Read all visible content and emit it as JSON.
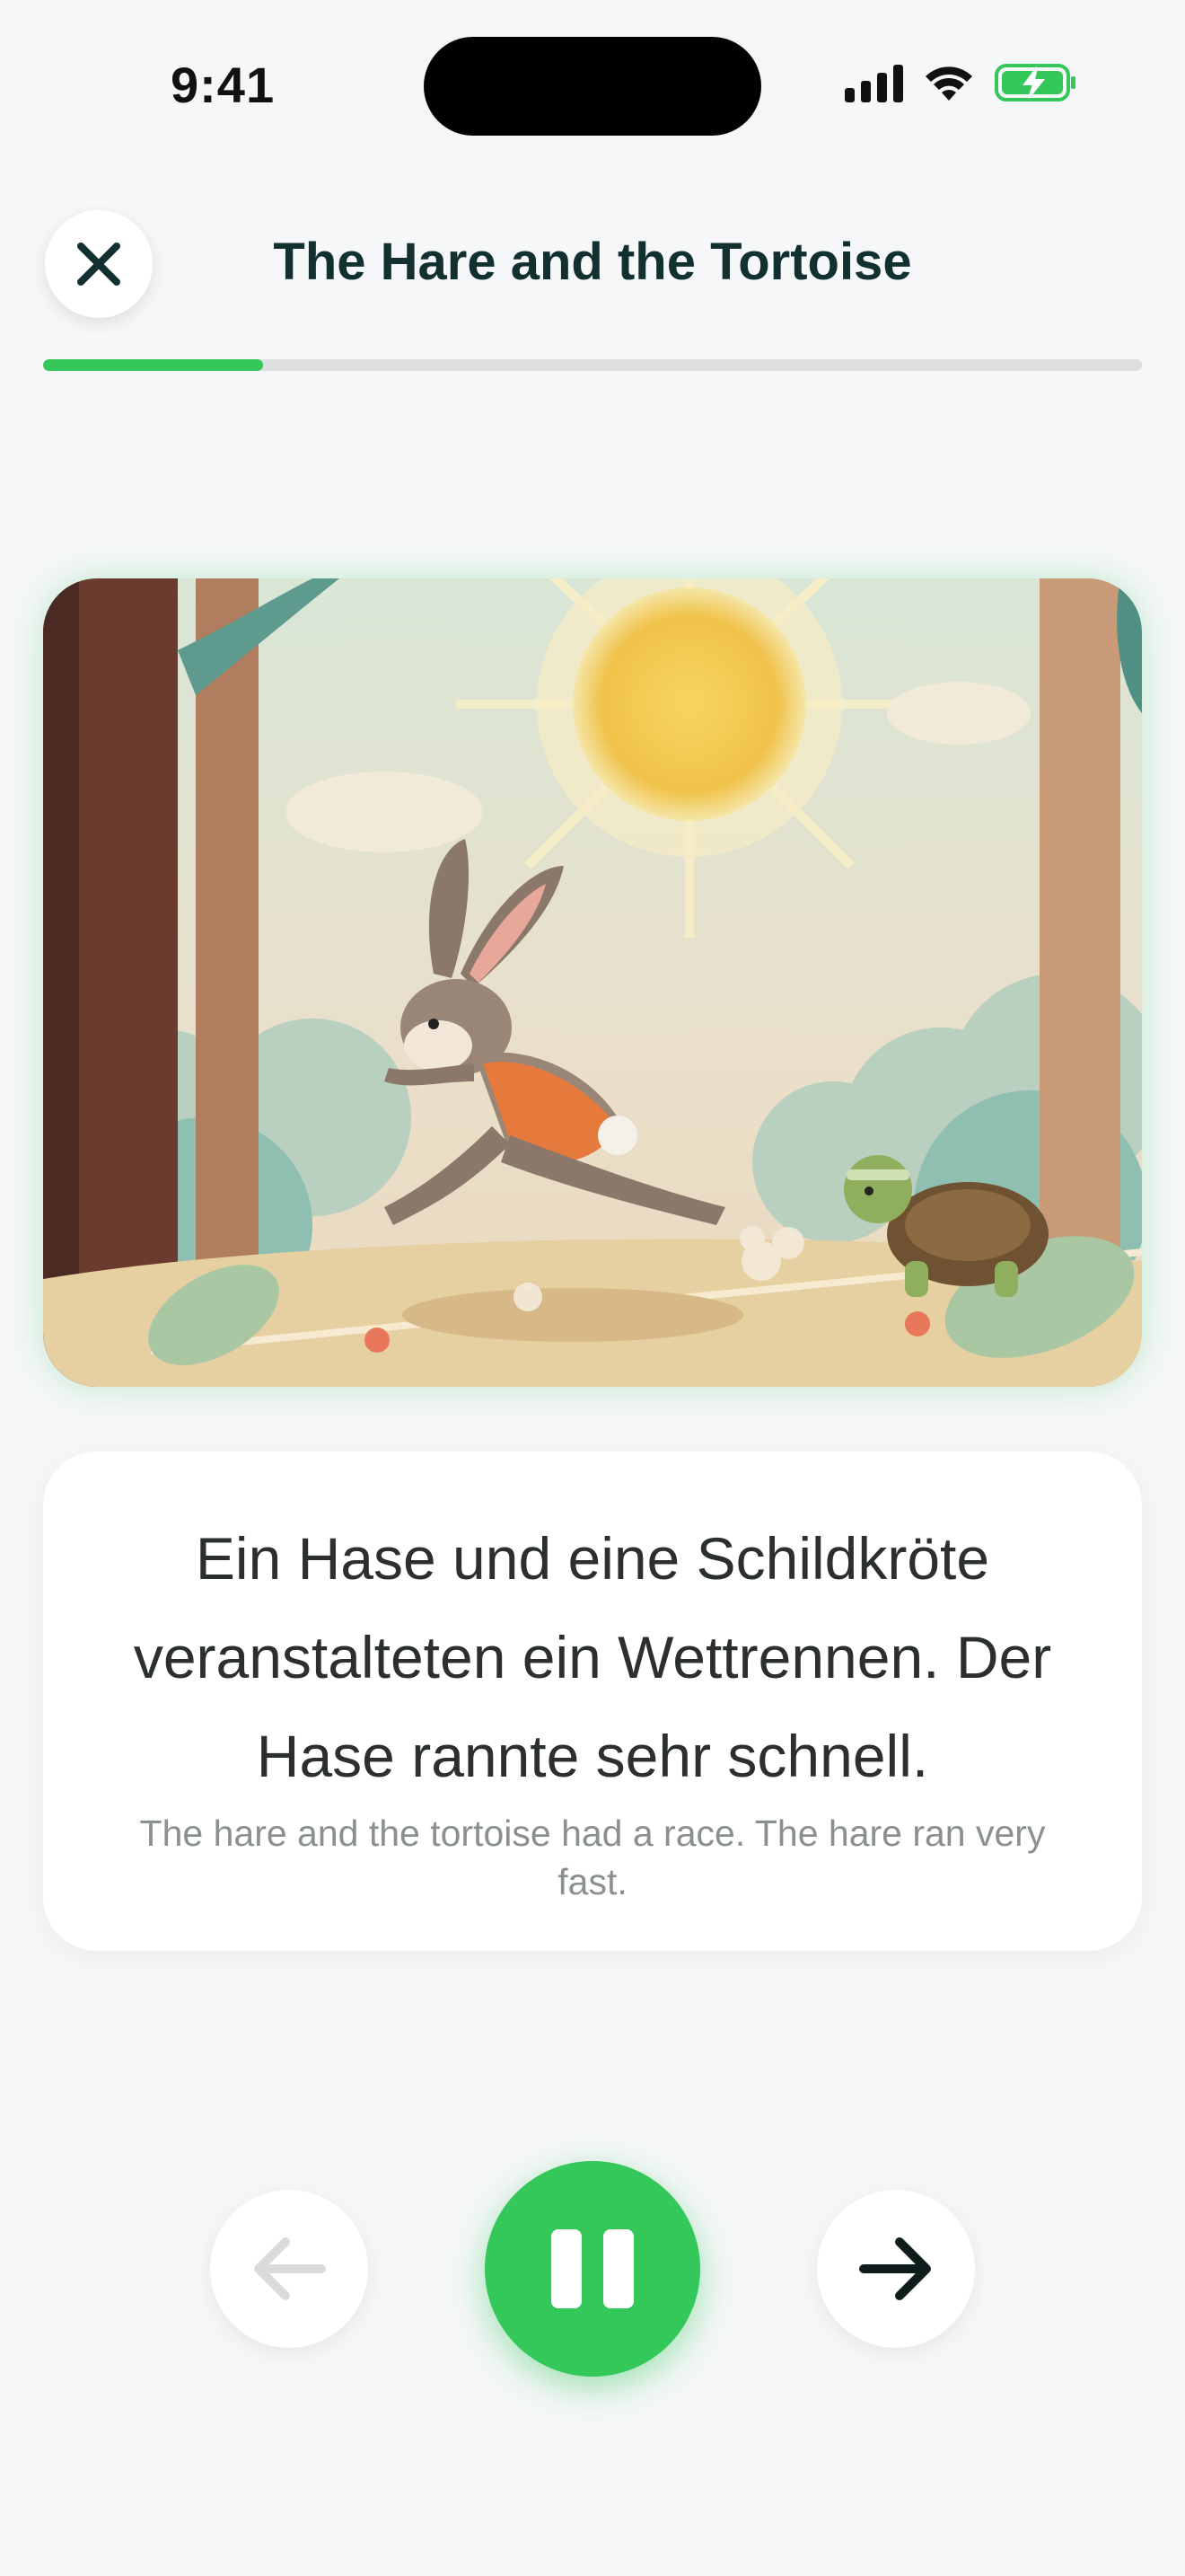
{
  "status_bar": {
    "time": "9:41"
  },
  "header": {
    "title": "The Hare and the Tortoise"
  },
  "progress": {
    "fraction": 0.2
  },
  "illustration": {
    "description_icon": "story-illustration"
  },
  "story": {
    "german": "Ein Hase und eine Schildkröte veranstalteten ein Wettrennen. Der Hase rannte sehr schnell.",
    "english": "The hare and the tortoise had a race. The hare ran very fast."
  },
  "controls": {
    "prev_icon": "arrow-left-icon",
    "play_state": "playing",
    "next_icon": "arrow-right-icon"
  },
  "colors": {
    "accent": "#34c759",
    "progress_track": "#dcdee0",
    "background": "#f6f7f9"
  }
}
